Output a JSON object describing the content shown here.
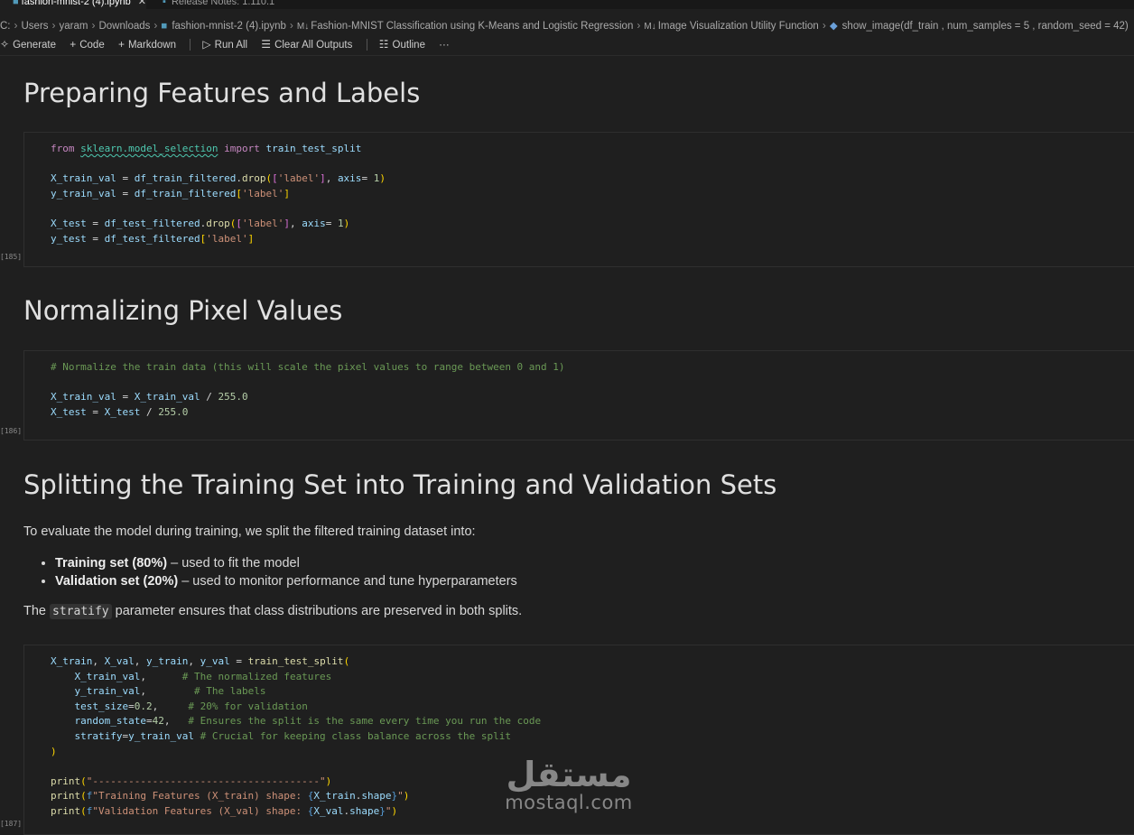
{
  "tabs": {
    "active_label": "fashion-mnist-2 (4).ipynb",
    "inactive_label": "Release Notes: 1.110.1"
  },
  "breadcrumb": {
    "drive": "C:",
    "users": "Users",
    "user": "yaram",
    "downloads": "Downloads",
    "file": "fashion-mnist-2 (4).ipynb",
    "section1": "Fashion-MNIST Classification using K-Means and Logistic Regression",
    "section2": "Image Visualization Utility Function",
    "symbol": "show_image(df_train , num_samples = 5 , random_seed = 42)"
  },
  "toolbar": {
    "generate": "Generate",
    "code": "Code",
    "markdown": "Markdown",
    "run_all": "Run All",
    "clear_all": "Clear All Outputs",
    "outline": "Outline",
    "more": "···"
  },
  "headings": {
    "h1": "Preparing Features and Labels",
    "h2": "Normalizing Pixel Values",
    "h3": "Splitting the Training Set into Training and Validation Sets"
  },
  "cells": {
    "c185": {
      "exec": "[185]"
    },
    "c186": {
      "exec": "[186]"
    },
    "c187": {
      "exec": "[187]"
    }
  },
  "markdown": {
    "intro": "To evaluate the model during training, we split the filtered training dataset into:",
    "bullet1_bold": "Training set (80%)",
    "bullet1_rest": " – used to fit the model",
    "bullet2_bold": "Validation set (20%)",
    "bullet2_rest": " – used to monitor performance and tune hyperparameters",
    "para_pre": "The ",
    "para_code": "stratify",
    "para_post": " parameter ensures that class distributions are preserved in both splits."
  },
  "watermark": {
    "arabic": "مستقل",
    "latin": "mostaql.com"
  }
}
